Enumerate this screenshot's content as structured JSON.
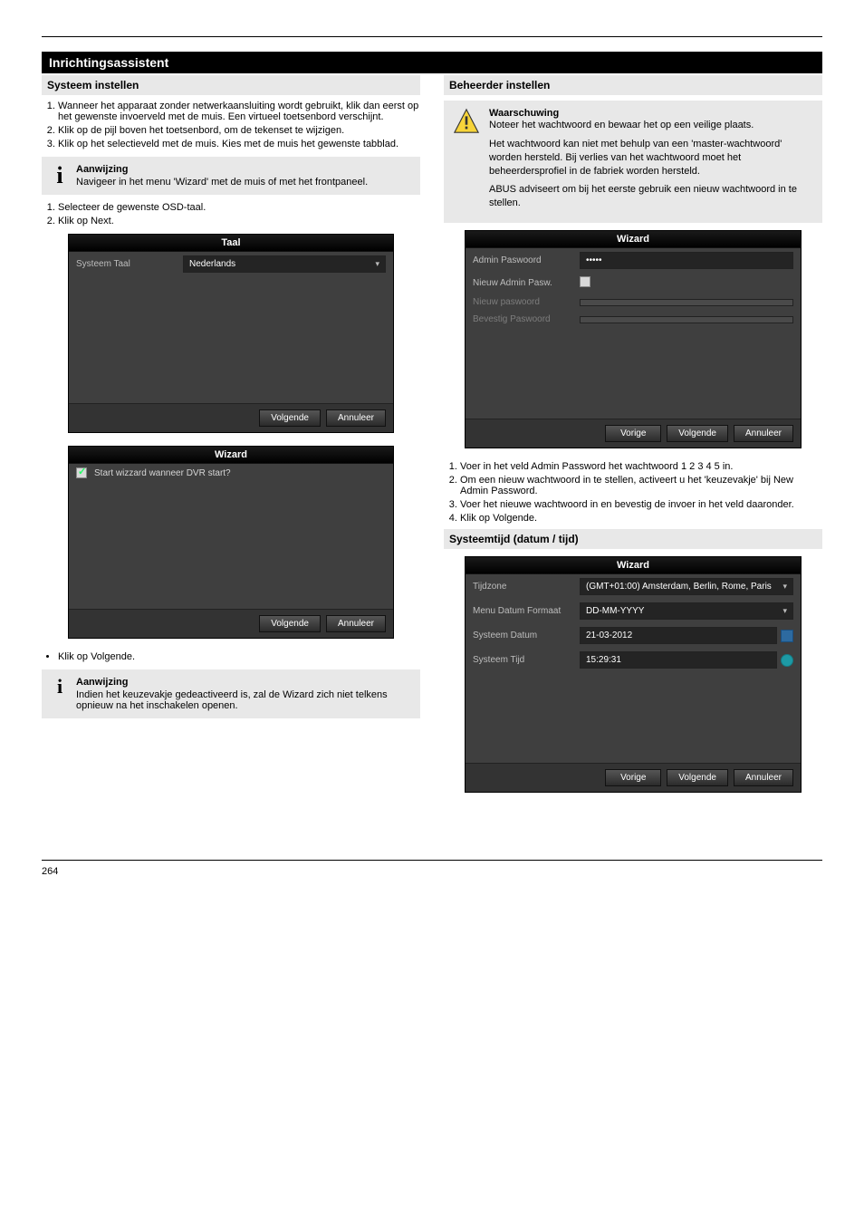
{
  "section_header": "Inrichtingsassistent",
  "col_left": {
    "heading": "Systeem instellen",
    "steps1": [
      "Wanneer het apparaat zonder netwerkaansluiting wordt gebruikt, klik dan eerst op het gewenste invoerveld met de muis. Een virtueel toetsenbord verschijnt.",
      "Klik op de pijl boven het toetsenbord, om de tekenset te wijzigen.",
      "Klik op het selectieveld met de muis. Kies met de muis het gewenste tabblad."
    ],
    "steps2": [
      "Selecteer de gewenste OSD-taal.",
      "Klik op Next."
    ],
    "info1_title": "Aanwijzing",
    "info1_text": "Navigeer in het menu 'Wizard' met de muis of met het frontpaneel.",
    "info2_title": "Aanwijzing",
    "info2_text": "Indien het keuzevakje gedeactiveerd is, zal de Wizard zich niet telkens opnieuw na het inschakelen openen.",
    "bullet1": "Klik op Volgende.",
    "taal_card": {
      "title": "Taal",
      "row_label": "Systeem Taal",
      "value": "Nederlands",
      "btn_next": "Volgende",
      "btn_cancel": "Annuleer"
    },
    "wiz1_card": {
      "title": "Wizard",
      "checkbox_label": "Start wizzard wanneer DVR start?",
      "btn_next": "Volgende",
      "btn_cancel": "Annuleer"
    }
  },
  "col_right": {
    "heading": "Beheerder instellen",
    "warn_title": "Waarschuwing",
    "warn_lines": [
      "Noteer het wachtwoord en bewaar het op een veilige plaats.",
      "Het wachtwoord kan niet met behulp van een 'master-wachtwoord' worden hersteld. Bij verlies van het wachtwoord moet het beheerdersprofiel in de fabriek worden hersteld.",
      "ABUS adviseert om bij het eerste gebruik een nieuw wachtwoord in te stellen."
    ],
    "wiz_admin": {
      "title": "Wizard",
      "rows": {
        "admin_pw": "Admin Paswoord",
        "admin_pw_val": "•••••",
        "new_admin": "Nieuw Admin Pasw.",
        "new_pw": "Nieuw paswoord",
        "confirm_pw": "Bevestig Paswoord"
      },
      "btn_prev": "Vorige",
      "btn_next": "Volgende",
      "btn_cancel": "Annuleer"
    },
    "post_admin_steps": [
      "Voer in het veld Admin Password het wachtwoord 1 2 3 4 5 in.",
      "Om een nieuw wachtwoord in te stellen, activeert u het 'keuzevakje' bij New Admin Password.",
      "Voer het nieuwe wachtwoord in en bevestig de invoer in het veld daaronder.",
      "Klik op Volgende."
    ],
    "time_heading": "Systeemtijd (datum / tijd)",
    "wiz_time": {
      "title": "Wizard",
      "rows": {
        "timezone_l": "Tijdzone",
        "timezone_v": "(GMT+01:00) Amsterdam, Berlin, Rome, Paris",
        "datefmt_l": "Menu Datum Formaat",
        "datefmt_v": "DD-MM-YYYY",
        "sysdate_l": "Systeem Datum",
        "sysdate_v": "21-03-2012",
        "systime_l": "Systeem Tijd",
        "systime_v": "15:29:31"
      },
      "btn_prev": "Vorige",
      "btn_next": "Volgende",
      "btn_cancel": "Annuleer"
    }
  },
  "footer_left": "264",
  "footer_right": ""
}
